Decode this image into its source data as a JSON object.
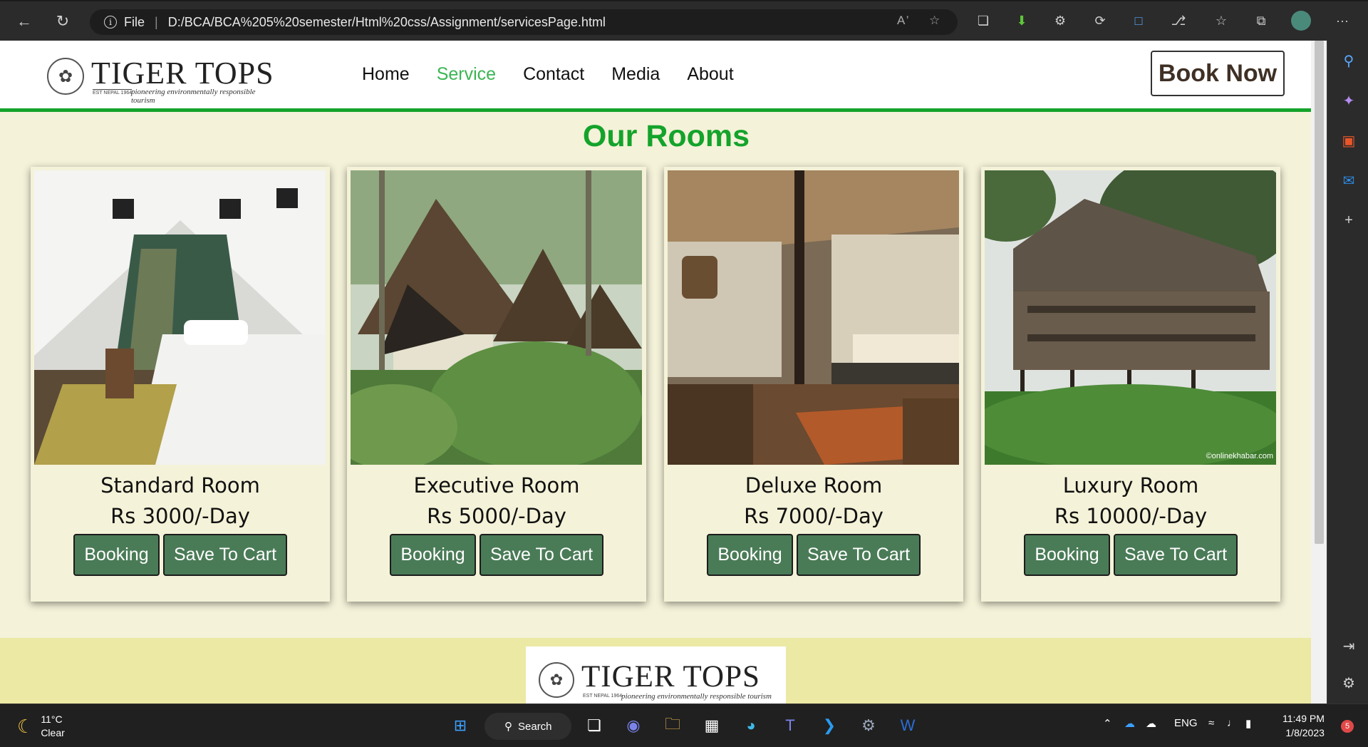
{
  "browser": {
    "address_file": "File",
    "address_url": "D:/BCA/BCA%205%20semester/Html%20css/Assignment/servicesPage.html",
    "read_aloud": "A̅",
    "menu_dots": "···"
  },
  "site": {
    "logo_name": "TIGER TOPS",
    "logo_est": "EST NEPAL 1964",
    "logo_tagline": "pioneering environmentally responsible tourism",
    "nav": [
      "Home",
      "Service",
      "Contact",
      "Media",
      "About"
    ],
    "book_now": "Book Now",
    "heading": "Our Rooms",
    "rooms": [
      {
        "name": "Standard Room",
        "price": "Rs 3000/-Day",
        "booking": "Booking",
        "cart": "Save To Cart",
        "photo": "tent-room"
      },
      {
        "name": "Executive Room",
        "price": "Rs 5000/-Day",
        "booking": "Booking",
        "cart": "Save To Cart",
        "photo": "jungle-cottages"
      },
      {
        "name": "Deluxe Room",
        "price": "Rs 7000/-Day",
        "booking": "Booking",
        "cart": "Save To Cart",
        "photo": "bedroom-interior"
      },
      {
        "name": "Luxury Room",
        "price": "Rs 10000/-Day",
        "booking": "Booking",
        "cart": "Save To Cart",
        "photo": "stilt-lodge",
        "watermark": "©onlinekhabar.com"
      }
    ]
  },
  "taskbar": {
    "temp": "11°C",
    "condition": "Clear",
    "search": "Search",
    "lang": "ENG",
    "time": "11:49 PM",
    "date": "1/8/2023",
    "notifications": "5"
  },
  "colors": {
    "accent_green": "#14a32b",
    "nav_active": "#3bb553",
    "button": "#4a7b57"
  }
}
